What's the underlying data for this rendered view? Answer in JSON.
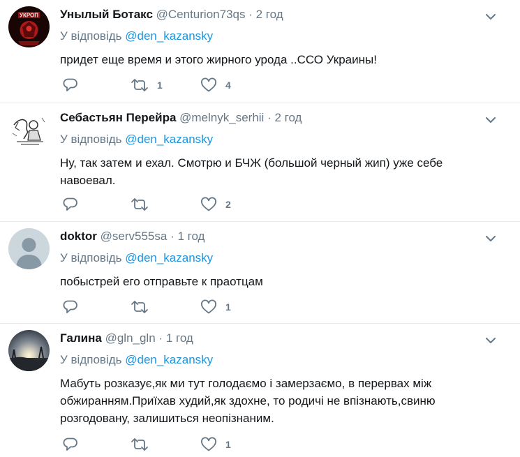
{
  "colors": {
    "link": "#1b95e0",
    "muted": "#657786",
    "text": "#14171a",
    "divider": "#e6ecf0"
  },
  "tweets": [
    {
      "name": "Унылый Ботакс",
      "handle": "@Centurion73qs",
      "time": "2 год",
      "dot": "·",
      "reply_prefix": "У відповідь",
      "reply_to": "@den_kazansky",
      "text": "придет еще время и этого жирного урода ..ССО  Украины!",
      "reply_count": "",
      "retweet_count": "1",
      "like_count": "4",
      "avatar_icon": "ukrop-logo-avatar"
    },
    {
      "name": "Себастьян Перейра",
      "handle": "@melnyk_serhii",
      "time": "2 год",
      "dot": "·",
      "reply_prefix": "У відповідь",
      "reply_to": "@den_kazansky",
      "text": "Ну, так затем и ехал. Смотрю и БЧЖ (большой черный жип) уже себе навоевал.",
      "reply_count": "",
      "retweet_count": "",
      "like_count": "2",
      "avatar_icon": "sketch-drawing-avatar"
    },
    {
      "name": "doktor",
      "handle": "@serv555sa",
      "time": "1 год",
      "dot": "·",
      "reply_prefix": "У відповідь",
      "reply_to": "@den_kazansky",
      "text": "побыстрей его отправьте к праотцам",
      "reply_count": "",
      "retweet_count": "",
      "like_count": "1",
      "avatar_icon": "default-user-avatar"
    },
    {
      "name": "Галина",
      "handle": "@gln_gln",
      "time": "1 год",
      "dot": "·",
      "reply_prefix": "У відповідь",
      "reply_to": "@den_kazansky",
      "text": "Мабуть розказує,як ми тут голодаємо і замерзаємо, в перервах між обжиранням.Приїхав худий,як здохне, то родичі не впізнають,свиню розгодовану, залишиться неопізнаним.",
      "reply_count": "",
      "retweet_count": "",
      "like_count": "1",
      "avatar_icon": "sunset-photo-avatar"
    }
  ]
}
